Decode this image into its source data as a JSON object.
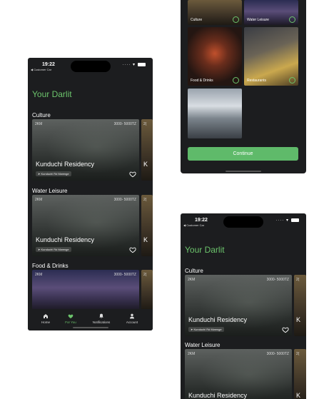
{
  "status": {
    "time": "19:22",
    "carrier": "◀ Customer Car",
    "signal": "····"
  },
  "app": {
    "title": "Your Darlit",
    "accent": "#6cc46c"
  },
  "sections": [
    {
      "title": "Culture",
      "card": {
        "distance": "2KM",
        "price": "3000- 5000TZ",
        "name": "Kunduchi Residency",
        "location": "Kunduchi Rd Mwenge"
      },
      "peek": {
        "distance": "2(",
        "name": "K"
      }
    },
    {
      "title": "Water Leisure",
      "card": {
        "distance": "2KM",
        "price": "3000- 5000TZ",
        "name": "Kunduchi Residency",
        "location": "Kunduchi Rd Mwenge"
      },
      "peek": {
        "distance": "2(",
        "name": "K"
      }
    },
    {
      "title": "Food & Drinks",
      "card": {
        "distance": "2KM",
        "price": "3000- 5000TZ"
      },
      "peek": {
        "distance": "2("
      }
    }
  ],
  "tabs": [
    {
      "label": "Home",
      "icon": "home-icon"
    },
    {
      "label": "For You",
      "icon": "heart-icon",
      "active": true
    },
    {
      "label": "Notifications",
      "icon": "bell-icon"
    },
    {
      "label": "Account",
      "icon": "person-icon"
    }
  ],
  "categories": [
    {
      "label": "Culture"
    },
    {
      "label": "Water Leisure"
    },
    {
      "label": "Food & Drinks"
    },
    {
      "label": "Restaurants"
    }
  ],
  "continue_label": "Continue",
  "screen3_sections": [
    {
      "title": "Culture",
      "card": {
        "distance": "2KM",
        "price": "3000- 5000TZ",
        "name": "Kunduchi Residency",
        "location": "Kunduchi Rd Mwenge"
      },
      "peek": {
        "distance": "2(",
        "name": "K"
      }
    },
    {
      "title": "Water Leisure",
      "card": {
        "distance": "2KM",
        "price": "3000- 5000TZ",
        "name": "Kunduchi Residency"
      },
      "peek": {
        "distance": "2(",
        "name": "K"
      }
    }
  ]
}
